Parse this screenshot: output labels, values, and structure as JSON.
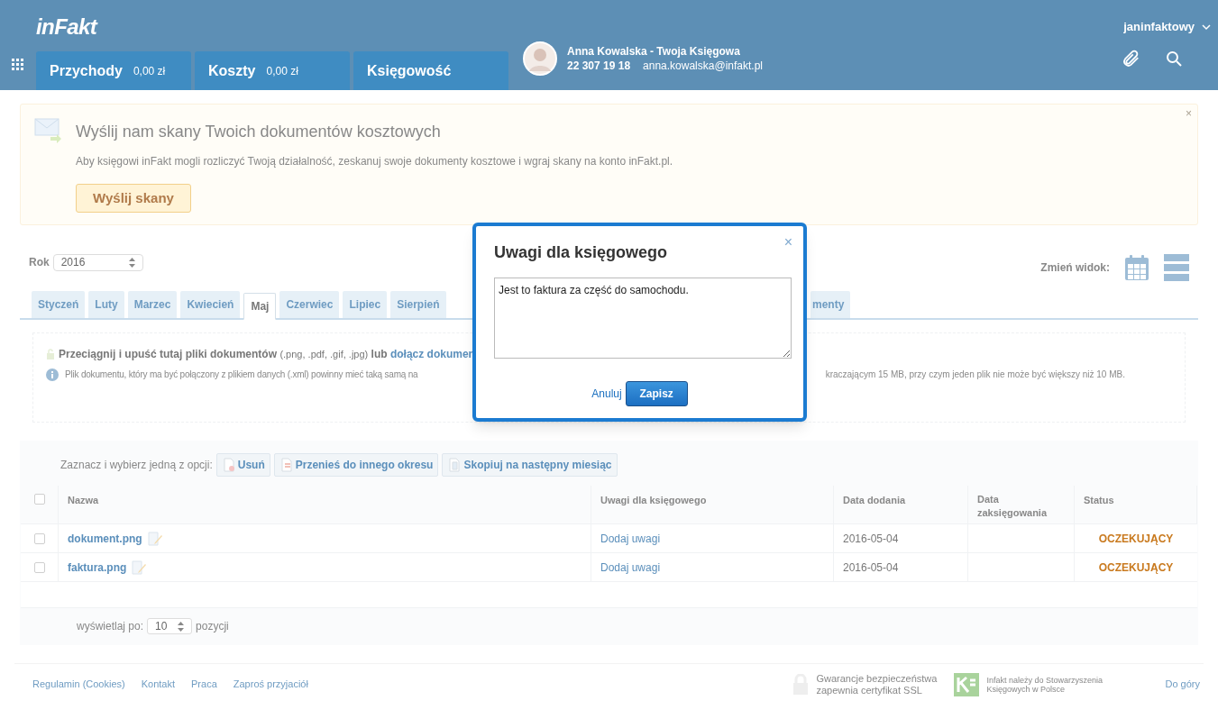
{
  "header": {
    "logo": "inFakt",
    "user": "janinfaktowy",
    "nav_tabs": [
      {
        "label": "Przychody",
        "amount": "0,00 zł"
      },
      {
        "label": "Koszty",
        "amount": "0,00 zł"
      },
      {
        "label": "Księgowość"
      }
    ],
    "accountant": {
      "name": "Anna Kowalska - Twoja Księgowa",
      "phone": "22 307 19 18",
      "email": "anna.kowalska@infakt.pl"
    }
  },
  "banner": {
    "title": "Wyślij nam skany Twoich dokumentów kosztowych",
    "text": "Aby księgowi inFakt mogli rozliczyć Twoją działalność, zeskanuj swoje dokumenty kosztowe i wgraj skany na konto inFakt.pl.",
    "button": "Wyślij skany",
    "close": "×"
  },
  "year": {
    "label": "Rok",
    "value": "2016"
  },
  "view": {
    "label": "Zmień widok:"
  },
  "months": [
    {
      "label": "Styczeń",
      "selected": false
    },
    {
      "label": "Luty",
      "selected": false
    },
    {
      "label": "Marzec",
      "selected": false
    },
    {
      "label": "Kwiecień",
      "selected": false
    },
    {
      "label": "Maj",
      "selected": true
    },
    {
      "label": "Czerwiec",
      "selected": false
    },
    {
      "label": "Lipiec",
      "selected": false
    },
    {
      "label": "Sierpień",
      "selected": false
    },
    {
      "label": "menty",
      "selected": false
    }
  ],
  "dropzone": {
    "line1_bold": "Przeciągnij i upuść tutaj pliki dokumentów",
    "line1_formats": "(.png, .pdf, .gif, .jpg)",
    "line1_or": "lub",
    "line1_link": "dołącz dokumen",
    "line2_left": "Plik dokumentu, który ma być połączony z plikiem danych (.xml) powinny mieć taką samą na",
    "line2_right": "kraczającym 15 MB, przy czym jeden plik nie może być większy niż 10 MB."
  },
  "toolbar": {
    "label": "Zaznacz i wybierz jedną z opcji:",
    "buttons": [
      {
        "kind": "delete",
        "label": "Usuń"
      },
      {
        "kind": "move",
        "label": "Przenieś do innego okresu"
      },
      {
        "kind": "copy",
        "label": "Skopiuj na następny miesiąc"
      }
    ]
  },
  "table": {
    "select_all_checked": false,
    "columns": [
      "Nazwa",
      "Uwagi dla księgowego",
      "Data dodania",
      "Data zaksięgowania",
      "Status"
    ],
    "rows": [
      {
        "checked": false,
        "name": "dokument.png",
        "note": "Dodaj uwagi",
        "added": "2016-05-04",
        "status": "OCZEKUJĄCY"
      },
      {
        "checked": false,
        "name": "faktura.png",
        "note": "Dodaj uwagi",
        "added": "2016-05-04",
        "status": "OCZEKUJĄCY"
      }
    ]
  },
  "pagination": {
    "label": "wyświetlaj po:",
    "value": "10",
    "suffix": "pozycji"
  },
  "footer": {
    "links": [
      "Regulamin (Cookies)",
      "Kontakt",
      "Praca",
      "Zaproś przyjaciół"
    ],
    "ssl": "Gwarancje bezpieczeństwa zapewnia certyfikat SSL",
    "skwp": "Infakt należy do Stowarzyszenia Księgowych w Polsce",
    "top": "Do góry"
  },
  "dialog": {
    "title": "Uwagi dla księgowego",
    "close": "×",
    "value": "Jest to faktura za część do samochodu.",
    "cancel": "Anuluj",
    "save": "Zapisz"
  }
}
